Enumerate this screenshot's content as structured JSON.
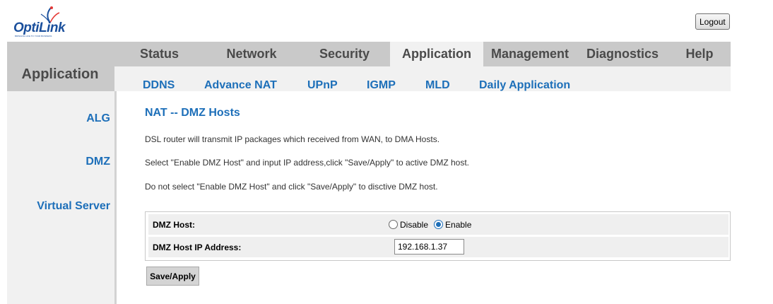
{
  "brand": {
    "logo_text_1": "Opti",
    "logo_text_2": "Link",
    "tagline": "BRINGING LIFE TO YOUR BUSINESS",
    "color_primary": "#1a4f9c",
    "color_accent": "#e53935"
  },
  "header": {
    "logout_label": "Logout"
  },
  "nav": {
    "section_label": "Application",
    "main_tabs": [
      {
        "label": "Status"
      },
      {
        "label": "Network"
      },
      {
        "label": "Security"
      },
      {
        "label": "Application",
        "active": true
      },
      {
        "label": "Management"
      },
      {
        "label": "Diagnostics"
      },
      {
        "label": "Help"
      }
    ],
    "sub_tabs": [
      {
        "label": "DDNS"
      },
      {
        "label": "Advance NAT"
      },
      {
        "label": "UPnP"
      },
      {
        "label": "IGMP"
      },
      {
        "label": "MLD"
      },
      {
        "label": "Daily Application"
      }
    ]
  },
  "sidebar": {
    "items": [
      {
        "label": "ALG"
      },
      {
        "label": "DMZ"
      },
      {
        "label": "Virtual Server"
      }
    ]
  },
  "main": {
    "title": "NAT -- DMZ Hosts",
    "descriptions": [
      "DSL router will transmit IP packages which received from WAN, to DMA Hosts.",
      "Select \"Enable DMZ Host\" and input IP address,click \"Save/Apply\" to active DMZ host.",
      "Do not select \"Enable DMZ Host\" and click \"Save/Apply\" to disctive DMZ host."
    ],
    "form": {
      "dmz_host_label": "DMZ Host:",
      "disable_label": "Disable",
      "enable_label": "Enable",
      "selected": "Enable",
      "ip_label": "DMZ Host IP Address:",
      "ip_value": "192.168.1.37"
    },
    "save_label": "Save/Apply"
  }
}
